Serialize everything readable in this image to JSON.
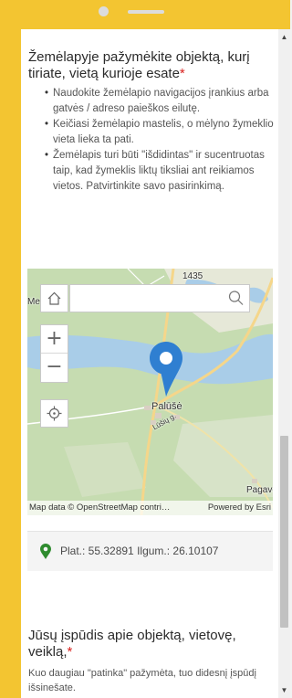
{
  "question1": {
    "title": "Žemėlapyje pažymėkite objektą, kurį tiriate, vietą kurioje esate",
    "required_mark": "*",
    "bullets": [
      "Naudokite žemėlapio navigacijos įrankius arba gatvės / adreso paieškos eilutę.",
      "Keičiasi žemėlapio mastelis, o mėlyno žymeklio vieta lieka ta pati.",
      "Žemėlapis turi būti \"išdidintas\" ir sucentruotas taip, kad žymeklis liktų tiksliai ant reikiamos vietos. Patvirtinkite savo pasirinkimą."
    ]
  },
  "map": {
    "search_placeholder": "",
    "zoom_in": "+",
    "zoom_out": "−",
    "labels": {
      "road_number": "1435",
      "town": "Palūšė",
      "street": "Lūšių g.",
      "village": "Pagavė",
      "left_edge": "Me"
    },
    "attribution_left": "Map data © OpenStreetMap contri…",
    "attribution_right": "Powered by Esri"
  },
  "coordinates": {
    "text": "Plat.: 55.32891  Ilgum.: 26.10107"
  },
  "question2": {
    "title": "Jūsų įspūdis apie objektą, vietovę, veiklą,",
    "required_mark": "*",
    "description": "Kuo daugiau \"patinka\" pažymėta, tuo didesnį įspūdį išsinešate."
  },
  "colors": {
    "frame": "#f3c531",
    "required": "#d9211e",
    "marker": "#2f7fd1",
    "coord_pin": "#2e8b2e",
    "water": "#a9cde8",
    "land": "#c6dcb1"
  }
}
